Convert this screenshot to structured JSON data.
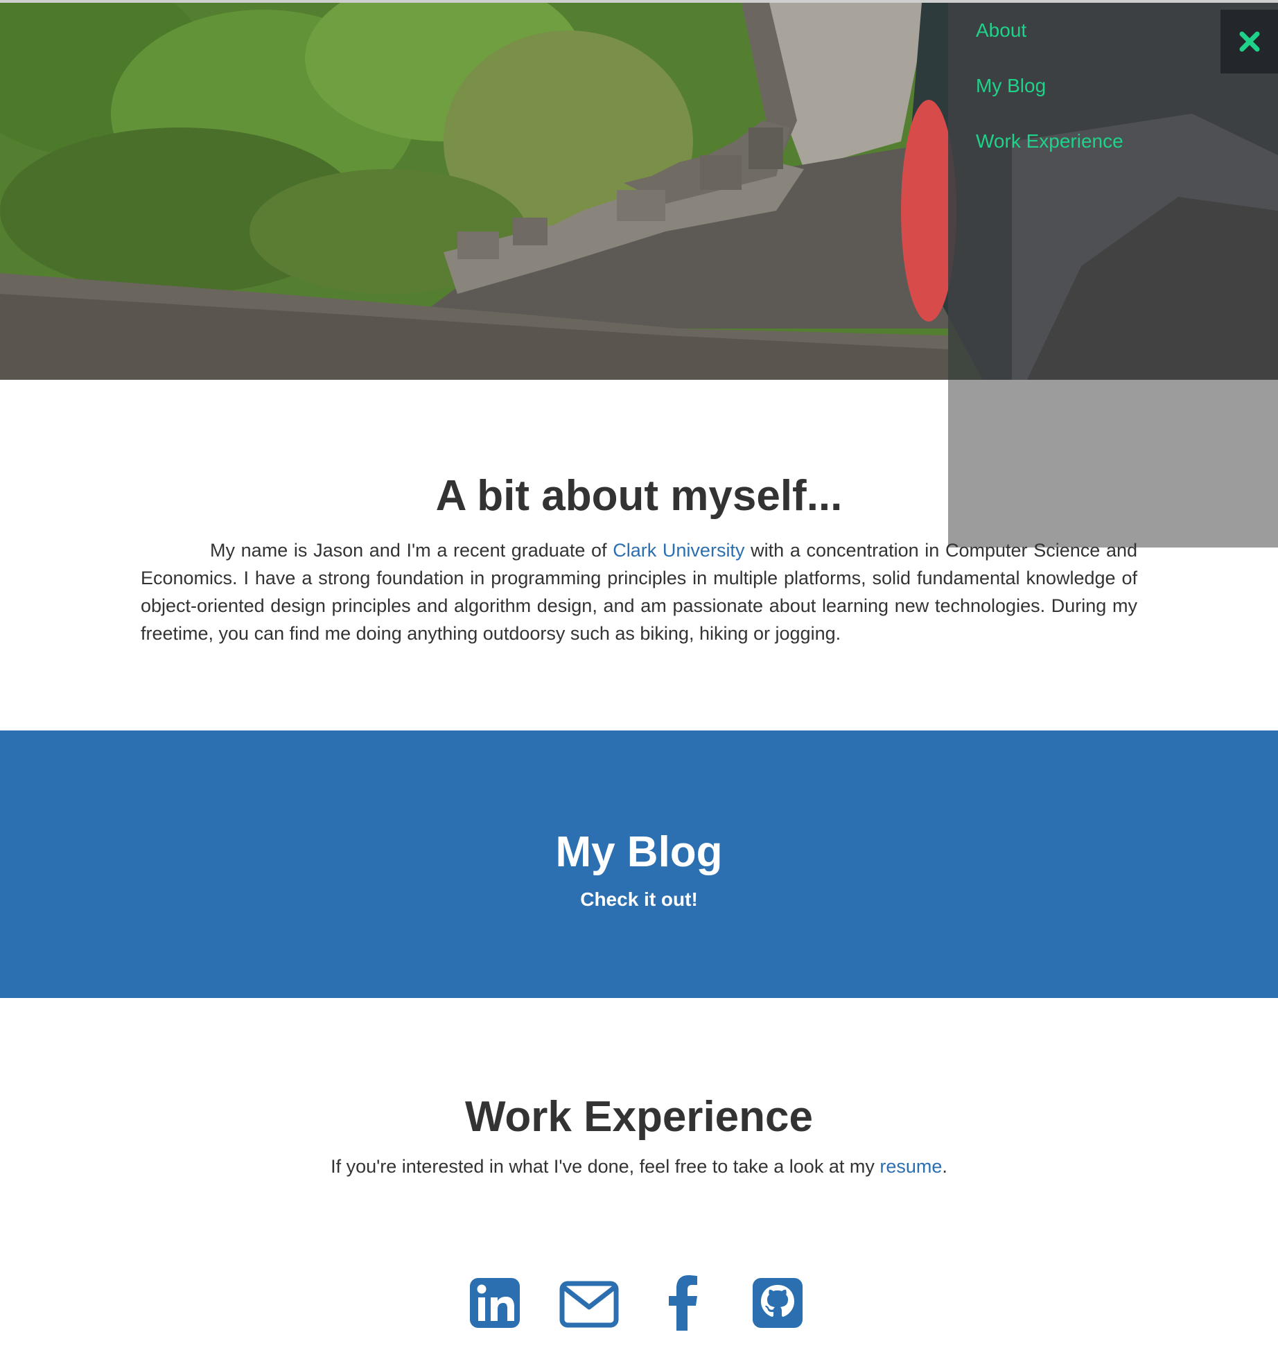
{
  "nav": {
    "items": [
      {
        "label": "About"
      },
      {
        "label": "My Blog"
      },
      {
        "label": "Work Experience"
      }
    ],
    "close_icon": "close-x-icon",
    "link_color": "#1fd28a"
  },
  "about": {
    "title": "A bit about myself...",
    "text_before": "My name is Jason and I'm a recent graduate of ",
    "link": "Clark University",
    "text_after": " with a concentration in Computer Science and Economics. I have a strong foundation in programming principles in multiple platforms, solid fundamental knowledge of object-oriented design principles and algorithm design, and am passionate about learning new technologies. During my freetime, you can find me doing anything outdoorsy such as biking, hiking or jogging."
  },
  "blog": {
    "title": "My Blog",
    "subtitle": "Check it out!",
    "background": "#2d70b1"
  },
  "work": {
    "title": "Work Experience",
    "text_before": "If you're interested in what I've done, feel free to take a look at my ",
    "link": "resume",
    "text_after": "."
  },
  "social": {
    "icons": [
      "linkedin-icon",
      "email-icon",
      "facebook-icon",
      "github-icon"
    ],
    "color": "#2b6fb0"
  },
  "colors": {
    "link": "#2b6fb0",
    "text": "#333333"
  }
}
